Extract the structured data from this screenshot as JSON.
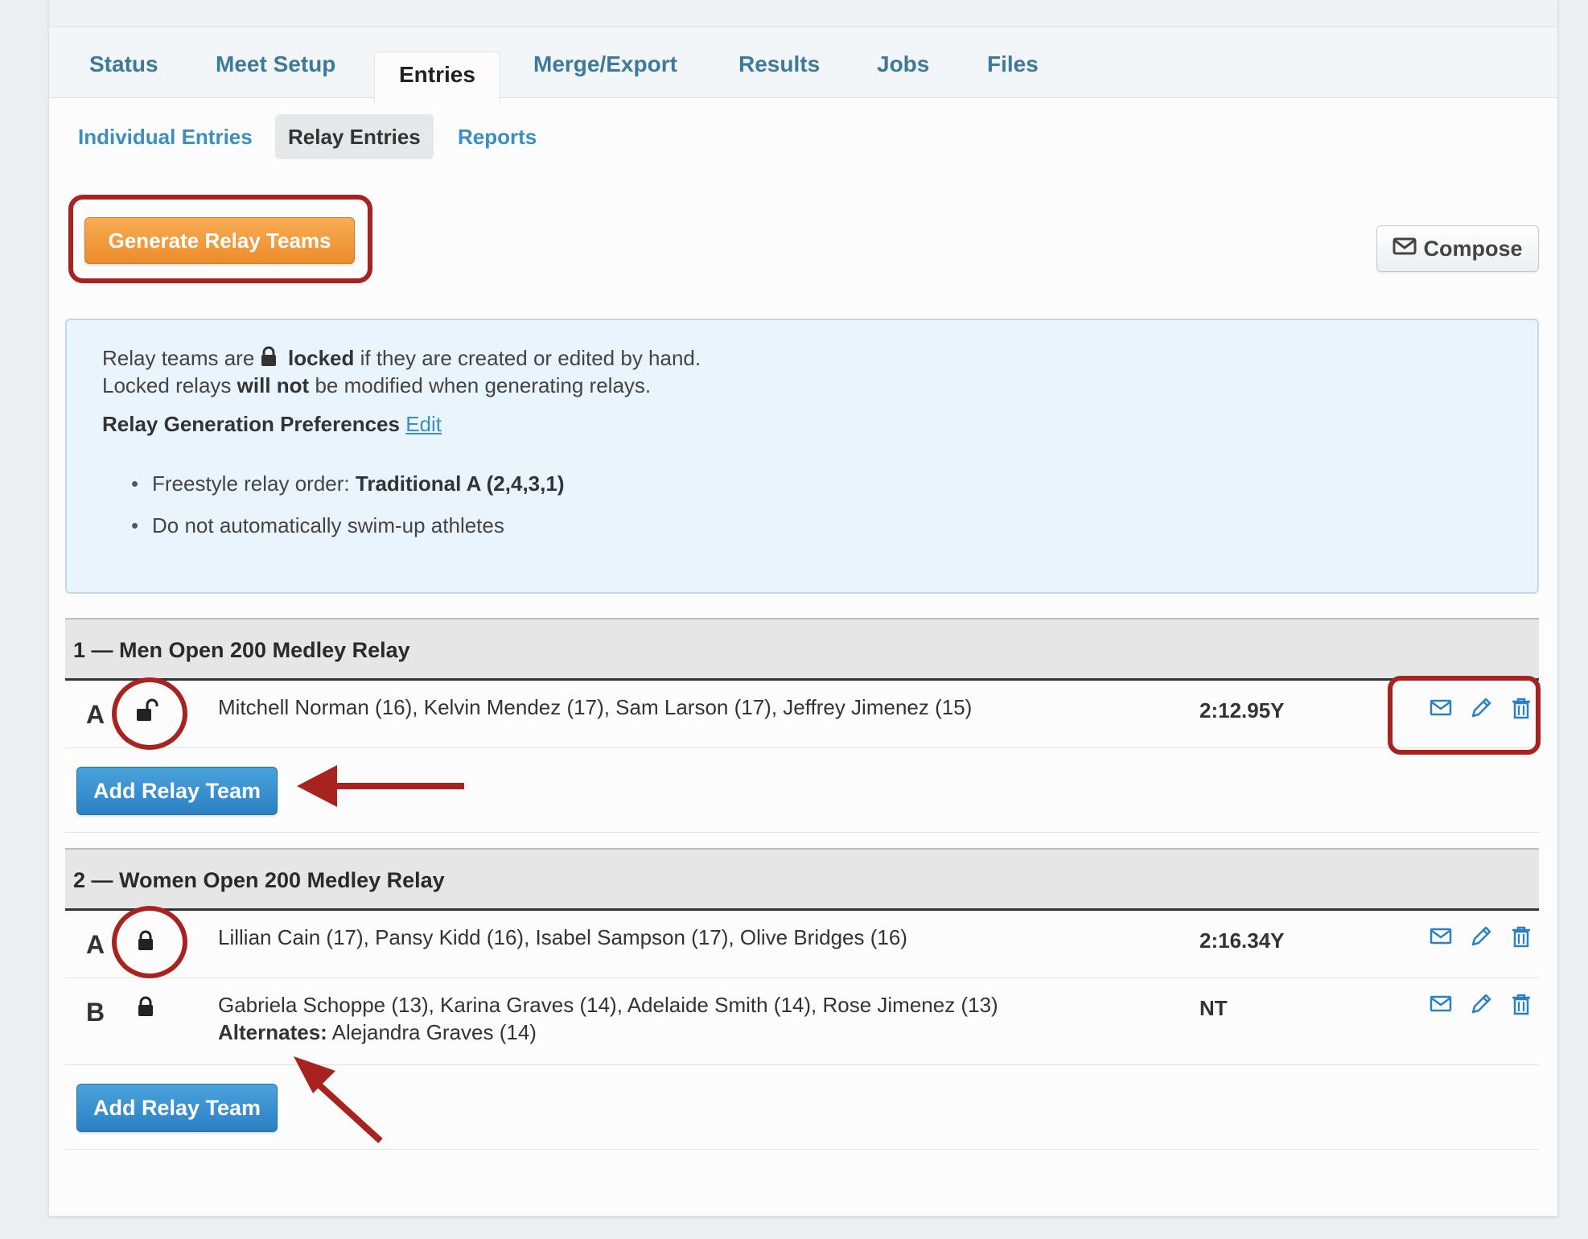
{
  "tabs": [
    "Status",
    "Meet Setup",
    "Entries",
    "Merge/Export",
    "Results",
    "Jobs",
    "Files"
  ],
  "active_tab": "Entries",
  "subtabs": [
    "Individual Entries",
    "Relay Entries",
    "Reports"
  ],
  "active_subtab": "Relay Entries",
  "toolbar": {
    "generate_label": "Generate Relay Teams",
    "compose_label": "Compose"
  },
  "info": {
    "line1_pre": "Relay teams are",
    "line1_bold": "locked",
    "line1_post": "if they are created or edited by hand.",
    "line2_pre": "Locked relays",
    "line2_bold": "will not",
    "line2_post": "be modified when generating relays.",
    "prefs_label": "Relay Generation Preferences",
    "prefs_edit": "Edit",
    "bullets": [
      {
        "text": "Freestyle relay order:",
        "bold": "Traditional A (2,4,3,1)"
      },
      {
        "text": "Do not automatically swim-up athletes",
        "bold": ""
      }
    ]
  },
  "events": [
    {
      "title": "1 — Men Open 200 Medley Relay",
      "teams": [
        {
          "letter": "A",
          "locked": false,
          "names": "Mitchell Norman (16), Kelvin Mendez (17), Sam Larson (17), Jeffrey Jimenez (15)",
          "alternates_label": "",
          "alternates": "",
          "time": "2:12.95Y"
        }
      ],
      "add_label": "Add Relay Team"
    },
    {
      "title": "2 — Women Open 200 Medley Relay",
      "teams": [
        {
          "letter": "A",
          "locked": true,
          "names": "Lillian Cain (17), Pansy Kidd (16), Isabel Sampson (17), Olive Bridges (16)",
          "alternates_label": "",
          "alternates": "",
          "time": "2:16.34Y"
        },
        {
          "letter": "B",
          "locked": true,
          "names": "Gabriela Schoppe (13), Karina Graves (14), Adelaide Smith (14), Rose Jimenez (13)",
          "alternates_label": "Alternates:",
          "alternates": "Alejandra Graves (14)",
          "time": "NT"
        }
      ],
      "add_label": "Add Relay Team"
    }
  ],
  "colors": {
    "accent_blue": "#3a8fbf",
    "orange_button": "#ee8b2a",
    "annotation_red": "#a8231f"
  },
  "icons": [
    "lock-icon",
    "unlock-icon",
    "envelope-icon",
    "pencil-icon",
    "trash-icon"
  ]
}
